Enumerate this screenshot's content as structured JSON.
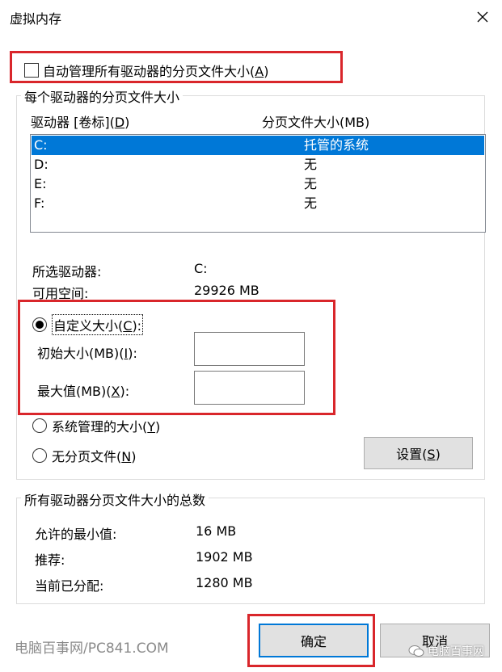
{
  "window": {
    "title": "虚拟内存"
  },
  "auto_manage": {
    "label": "自动管理所有驱动器的分页文件大小",
    "hotkey": "A",
    "checked": false
  },
  "per_drive": {
    "group_title": "每个驱动器的分页文件大小",
    "col_drive": "驱动器 [卷标]",
    "col_drive_hotkey": "D",
    "col_size": "分页文件大小(MB)",
    "rows": [
      {
        "drive": "C:",
        "size": "托管的系统",
        "selected": true
      },
      {
        "drive": "D:",
        "size": "无",
        "selected": false
      },
      {
        "drive": "E:",
        "size": "无",
        "selected": false
      },
      {
        "drive": "F:",
        "size": "无",
        "selected": false
      }
    ],
    "selected_drive_label": "所选驱动器:",
    "selected_drive_value": "C:",
    "free_space_label": "可用空间:",
    "free_space_value": "29926 MB",
    "custom_size": {
      "label": "自定义大小",
      "hotkey": "C",
      "selected": true
    },
    "initial_size": {
      "label": "初始大小(MB)",
      "hotkey": "I",
      "value": ""
    },
    "max_size": {
      "label": "最大值(MB)",
      "hotkey": "X",
      "value": ""
    },
    "system_managed": {
      "label": "系统管理的大小",
      "hotkey": "Y",
      "selected": false
    },
    "no_paging": {
      "label": "无分页文件",
      "hotkey": "N",
      "selected": false
    },
    "set_button": {
      "label": "设置",
      "hotkey": "S"
    }
  },
  "totals": {
    "group_title": "所有驱动器分页文件大小的总数",
    "min_label": "允许的最小值:",
    "min_value": "16 MB",
    "recommended_label": "推荐:",
    "recommended_value": "1902 MB",
    "current_label": "当前已分配:",
    "current_value": "1280 MB"
  },
  "buttons": {
    "ok": "确定",
    "cancel": "取消"
  },
  "watermark": {
    "left": "电脑百事网/PC841.COM",
    "right": "电脑百事网"
  },
  "colors": {
    "selection": "#0078d7",
    "highlight": "#d9262b"
  }
}
